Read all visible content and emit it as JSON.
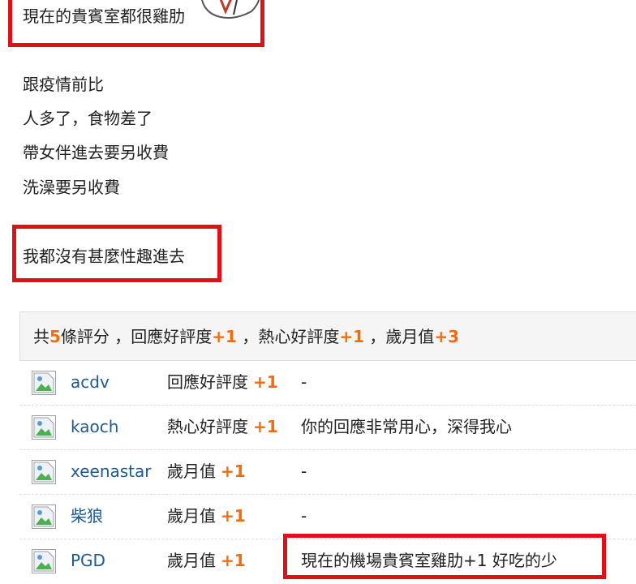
{
  "post": {
    "top_line": "現在的貴賓室都很雞肋",
    "lines": [
      "跟疫情前比",
      "人多了，食物差了",
      "帶女伴進去要另收費",
      "洗澡要另收費"
    ],
    "conclusion": "我都沒有甚麼性趣進去"
  },
  "rating_summary": {
    "prefix": "共",
    "count": "5",
    "count_suffix": "條評分 ，",
    "item1_label": "回應好評度",
    "item1_value": "+1",
    "sep1": " ，",
    "item2_label": "熱心好評度",
    "item2_value": "+1",
    "sep2": " ，",
    "item3_label": "歲月值",
    "item3_value": "+3"
  },
  "ratings": [
    {
      "user": "acdv",
      "type": "回應好評度",
      "value": "+1",
      "reason": "-"
    },
    {
      "user": "kaoch",
      "type": "熱心好評度",
      "value": "+1",
      "reason": "你的回應非常用心，深得我心"
    },
    {
      "user": "xeenastar",
      "type": "歲月值",
      "value": "+1",
      "reason": "-"
    },
    {
      "user": "柴狼",
      "type": "歲月值",
      "value": "+1",
      "reason": "-"
    },
    {
      "user": "PGD",
      "type": "歲月值",
      "value": "+1",
      "reason": "現在的機場貴賓室雞肋+1 好吃的少"
    }
  ],
  "colors": {
    "highlight_box": "#e0101a",
    "score": "#f26c0f",
    "username": "#1f5a8e"
  },
  "icons": {
    "avatar": "broken-image-icon",
    "sticker": "sticker-image"
  }
}
